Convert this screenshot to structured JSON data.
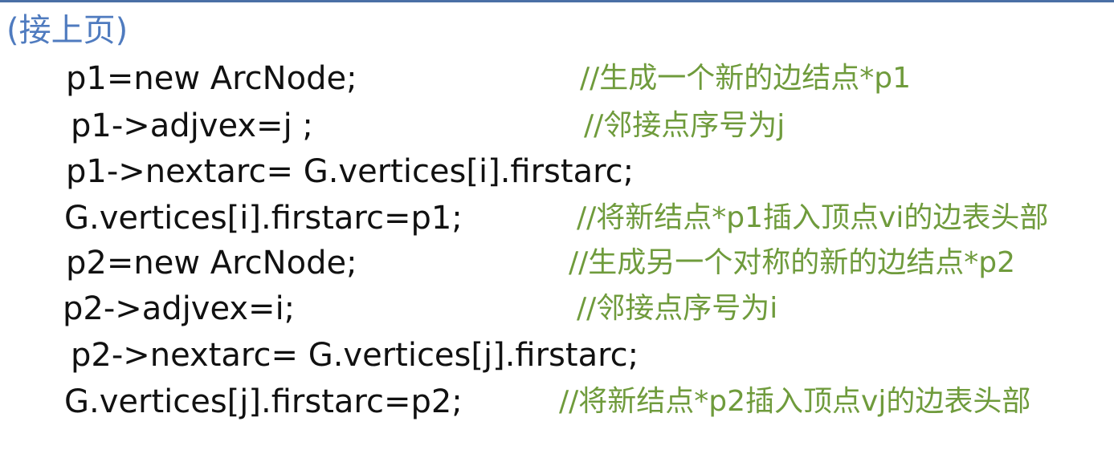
{
  "header": "(接上页)",
  "lines": [
    {
      "code": "p1=new ArcNode;",
      "comment": "//生成一个新的边结点*p1"
    },
    {
      "code": "p1->adjvex=j ;",
      "comment": "//邻接点序号为j"
    },
    {
      "code": "p1->nextarc= G.vertices[i].firstarc;",
      "comment": ""
    },
    {
      "code": "G.vertices[i].firstarc=p1;",
      "comment": "//将新结点*p1插入顶点vi的边表头部"
    },
    {
      "code": "p2=new ArcNode;",
      "comment": "//生成另一个对称的新的边结点*p2"
    },
    {
      "code": "p2->adjvex=i;",
      "comment": "//邻接点序号为i"
    },
    {
      "code": "p2->nextarc= G.vertices[j].firstarc;",
      "comment": ""
    },
    {
      "code": "G.vertices[j].firstarc=p2;",
      "comment": "//将新结点*p2插入顶点vj的边表头部"
    }
  ]
}
